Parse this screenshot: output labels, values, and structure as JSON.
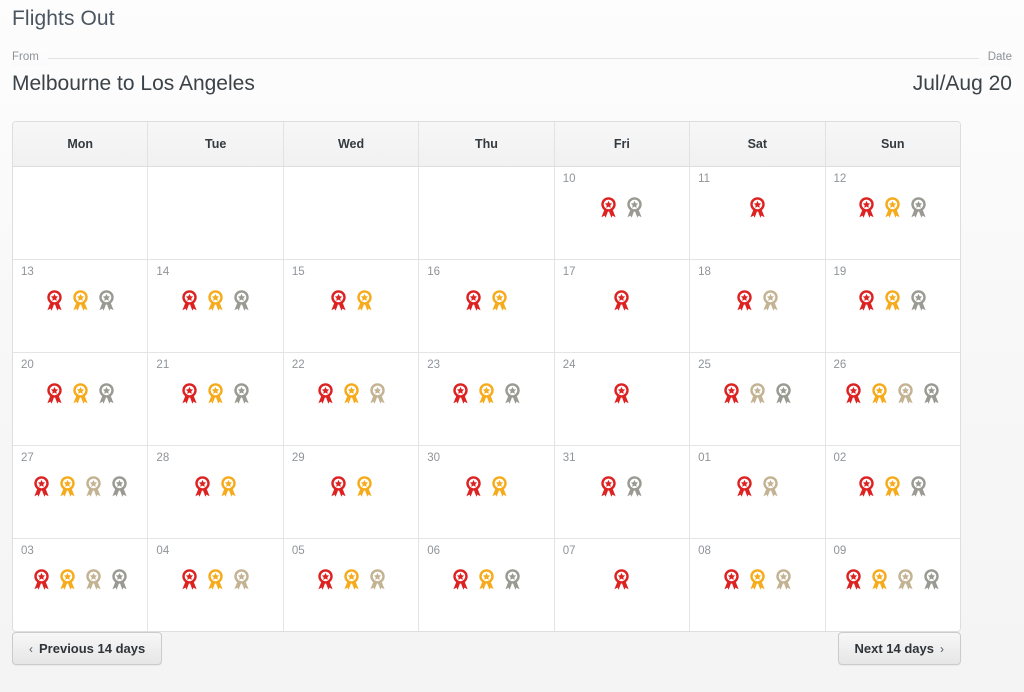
{
  "header": {
    "title": "Flights Out",
    "from_label": "From",
    "route": "Melbourne to Los Angeles",
    "date_label": "Date",
    "date_value": "Jul/Aug 20"
  },
  "calendar": {
    "day_headers": [
      "Mon",
      "Tue",
      "Wed",
      "Thu",
      "Fri",
      "Sat",
      "Sun"
    ],
    "award_colors": {
      "red": "#dd2222",
      "orange": "#f6ab1c",
      "tan": "#c3b393",
      "gray": "#9a9a93"
    },
    "weeks": [
      [
        {
          "day": "",
          "awards": []
        },
        {
          "day": "",
          "awards": []
        },
        {
          "day": "",
          "awards": []
        },
        {
          "day": "",
          "awards": []
        },
        {
          "day": "10",
          "awards": [
            "red",
            "gray"
          ]
        },
        {
          "day": "11",
          "awards": [
            "red"
          ]
        },
        {
          "day": "12",
          "awards": [
            "red",
            "orange",
            "gray"
          ]
        }
      ],
      [
        {
          "day": "13",
          "awards": [
            "red",
            "orange",
            "gray"
          ]
        },
        {
          "day": "14",
          "awards": [
            "red",
            "orange",
            "gray"
          ]
        },
        {
          "day": "15",
          "awards": [
            "red",
            "orange"
          ]
        },
        {
          "day": "16",
          "awards": [
            "red",
            "orange"
          ]
        },
        {
          "day": "17",
          "awards": [
            "red"
          ]
        },
        {
          "day": "18",
          "awards": [
            "red",
            "tan"
          ]
        },
        {
          "day": "19",
          "awards": [
            "red",
            "orange",
            "gray"
          ]
        }
      ],
      [
        {
          "day": "20",
          "awards": [
            "red",
            "orange",
            "gray"
          ]
        },
        {
          "day": "21",
          "awards": [
            "red",
            "orange",
            "gray"
          ]
        },
        {
          "day": "22",
          "awards": [
            "red",
            "orange",
            "tan"
          ]
        },
        {
          "day": "23",
          "awards": [
            "red",
            "orange",
            "gray"
          ]
        },
        {
          "day": "24",
          "awards": [
            "red"
          ]
        },
        {
          "day": "25",
          "awards": [
            "red",
            "tan",
            "gray"
          ]
        },
        {
          "day": "26",
          "awards": [
            "red",
            "orange",
            "tan",
            "gray"
          ]
        }
      ],
      [
        {
          "day": "27",
          "awards": [
            "red",
            "orange",
            "tan",
            "gray"
          ]
        },
        {
          "day": "28",
          "awards": [
            "red",
            "orange"
          ]
        },
        {
          "day": "29",
          "awards": [
            "red",
            "orange"
          ]
        },
        {
          "day": "30",
          "awards": [
            "red",
            "orange"
          ]
        },
        {
          "day": "31",
          "awards": [
            "red",
            "gray"
          ]
        },
        {
          "day": "01",
          "awards": [
            "red",
            "tan"
          ]
        },
        {
          "day": "02",
          "awards": [
            "red",
            "orange",
            "gray"
          ]
        }
      ],
      [
        {
          "day": "03",
          "awards": [
            "red",
            "orange",
            "tan",
            "gray"
          ]
        },
        {
          "day": "04",
          "awards": [
            "red",
            "orange",
            "tan"
          ]
        },
        {
          "day": "05",
          "awards": [
            "red",
            "orange",
            "tan"
          ]
        },
        {
          "day": "06",
          "awards": [
            "red",
            "orange",
            "gray"
          ]
        },
        {
          "day": "07",
          "awards": [
            "red"
          ]
        },
        {
          "day": "08",
          "awards": [
            "red",
            "orange",
            "tan"
          ]
        },
        {
          "day": "09",
          "awards": [
            "red",
            "orange",
            "tan",
            "gray"
          ]
        }
      ]
    ]
  },
  "footer": {
    "prev_chevron": "‹",
    "prev_label": "Previous 14 days",
    "next_label": "Next 14 days",
    "next_chevron": "›"
  }
}
